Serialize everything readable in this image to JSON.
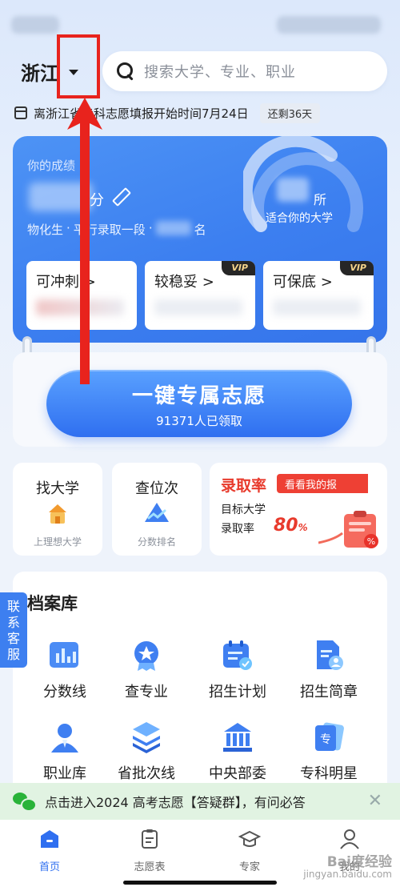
{
  "header": {
    "province": "浙江",
    "search_placeholder": "搜索大学、专业、职业"
  },
  "notice": {
    "text": "离浙江省专科志愿填报开始时间7月24日",
    "remaining": "还剩36天"
  },
  "score_card": {
    "label": "你的成绩",
    "score_unit": "分",
    "subject": "物化生",
    "batch": "平行录取一段",
    "rank_unit": "名",
    "fit_unit": "所",
    "fit_label": "适合你的大学",
    "tiers": [
      {
        "label": "可冲刺 >",
        "badge": "VIP"
      },
      {
        "label": "较稳妥 >",
        "badge": "VIP"
      },
      {
        "label": "可保底 >",
        "badge": "VIP"
      }
    ]
  },
  "cta": {
    "title": "一键专属志愿",
    "subtitle": "91371人已领取"
  },
  "tools": [
    {
      "title": "找大学",
      "sub": "上理想大学",
      "icon": "university-building-icon"
    },
    {
      "title": "查位次",
      "sub": "分数排名",
      "icon": "rank-chart-icon"
    }
  ],
  "admission_rate": {
    "title": "录取率",
    "pill": "看看我的报",
    "line1": "目标大学",
    "line2": "录取率",
    "percent": "80",
    "percent_unit": "%"
  },
  "archive": {
    "title": "档案库",
    "items": [
      {
        "label": "分数线",
        "icon": "score-line-icon"
      },
      {
        "label": "查专业",
        "icon": "major-badge-icon"
      },
      {
        "label": "招生计划",
        "icon": "enroll-plan-icon"
      },
      {
        "label": "招生简章",
        "icon": "brochure-icon"
      },
      {
        "label": "职业库",
        "icon": "career-icon"
      },
      {
        "label": "省批次线",
        "icon": "batch-line-icon"
      },
      {
        "label": "中央部委\n直属院校",
        "icon": "central-school-icon"
      },
      {
        "label": "专科明星\n院校",
        "icon": "star-college-icon"
      }
    ]
  },
  "service": {
    "label": "联系客服"
  },
  "wechat_banner": {
    "text": "点击进入2024 高考志愿【答疑群】，有问必答",
    "close": "✕"
  },
  "nav": [
    {
      "label": "首页",
      "active": true
    },
    {
      "label": "志愿表",
      "active": false
    },
    {
      "label": "专家",
      "active": false
    },
    {
      "label": "我的",
      "active": false
    }
  ],
  "watermark": {
    "brand": "Bai度经验",
    "url": "jingyan.baidu.com"
  },
  "colors": {
    "primary": "#2f6ff0",
    "red": "#e83a2c",
    "annotation": "#e8231d",
    "wechat_green": "#29b339"
  }
}
